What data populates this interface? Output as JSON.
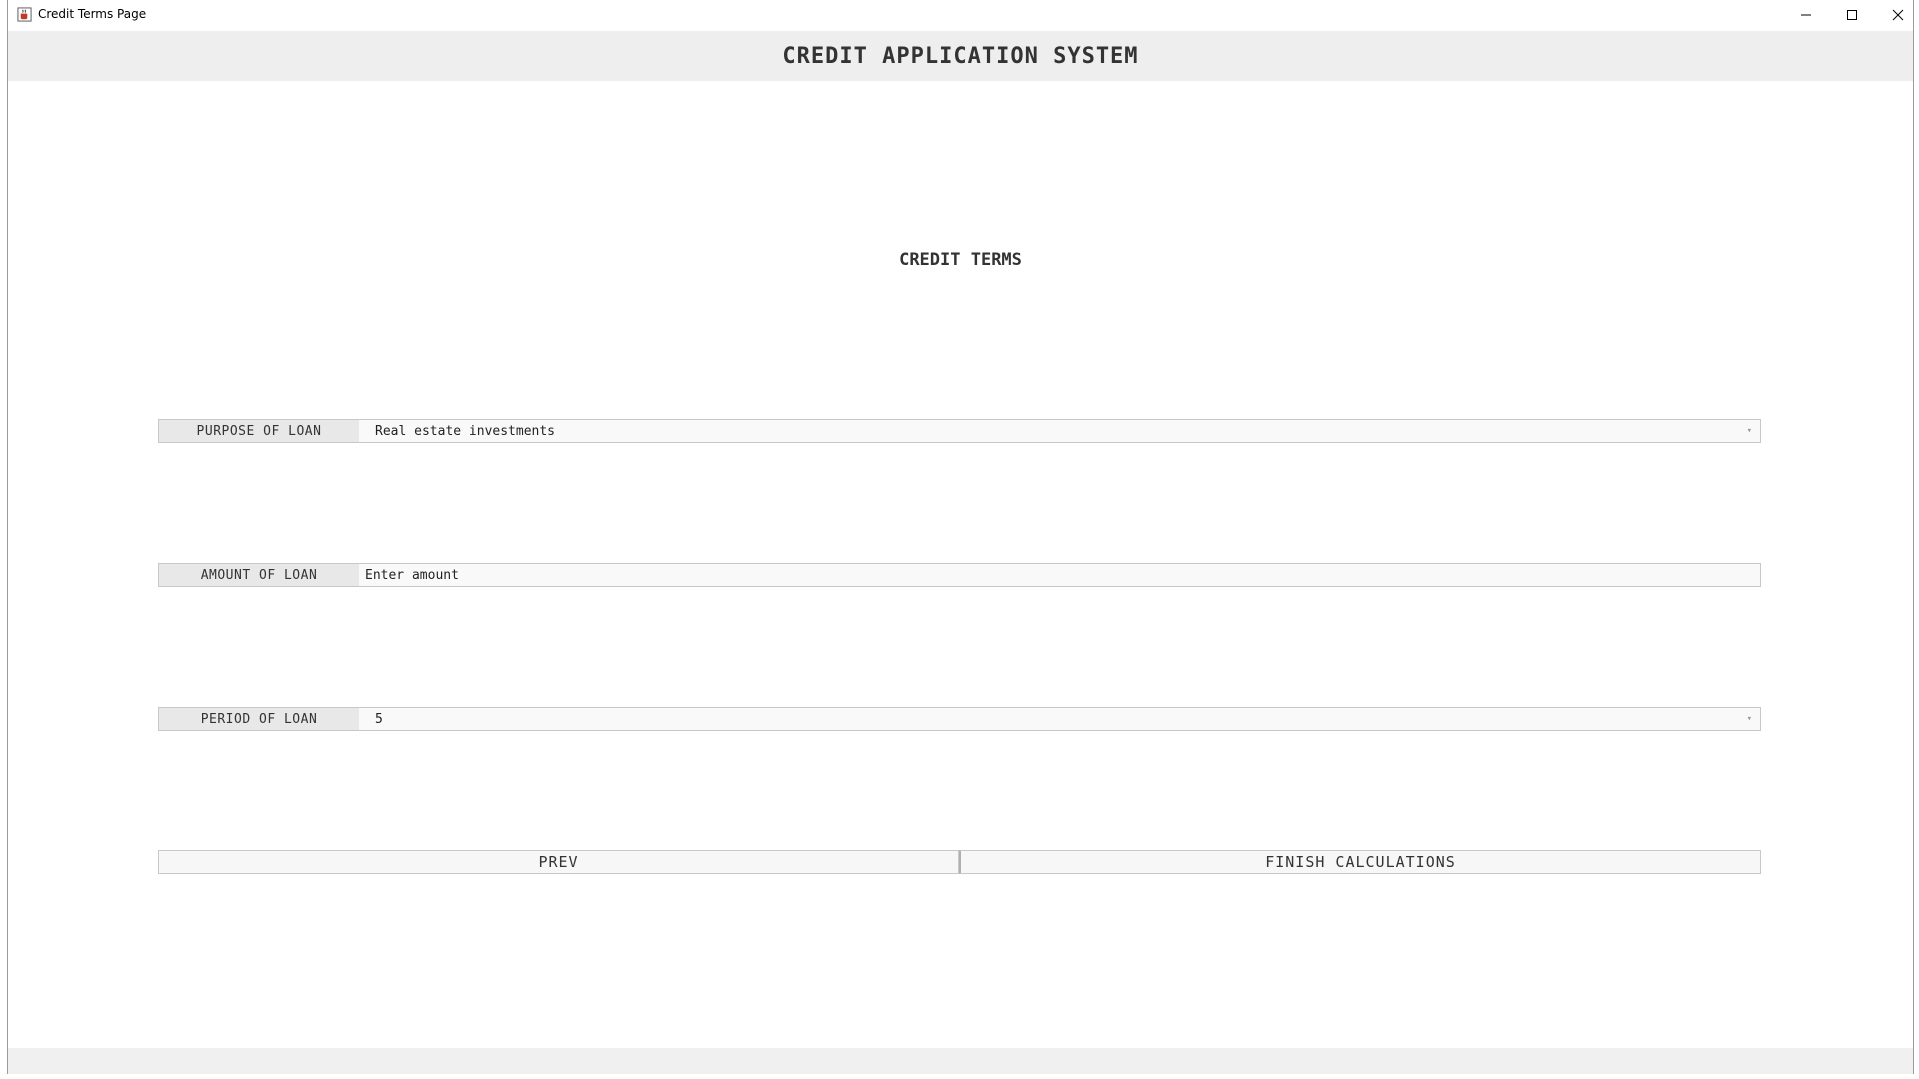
{
  "window": {
    "title": "Credit Terms Page",
    "icons": {
      "app": "java-cup-icon",
      "minimize": "minimize-icon",
      "maximize": "maximize-icon",
      "close": "close-icon"
    }
  },
  "header": {
    "title": "CREDIT APPLICATION SYSTEM"
  },
  "section": {
    "title": "CREDIT TERMS"
  },
  "form": {
    "purpose": {
      "label": "PURPOSE OF LOAN",
      "value": "Real estate investments"
    },
    "amount": {
      "label": "AMOUNT OF LOAN",
      "placeholder": "Enter amount"
    },
    "period": {
      "label": "PERIOD OF LOAN",
      "value": "5"
    }
  },
  "buttons": {
    "prev": "PREV",
    "finish": "FINISH CALCULATIONS"
  },
  "colors": {
    "header_bg": "#eeeeee",
    "text": "#333333",
    "border": "#c8c8c8"
  }
}
